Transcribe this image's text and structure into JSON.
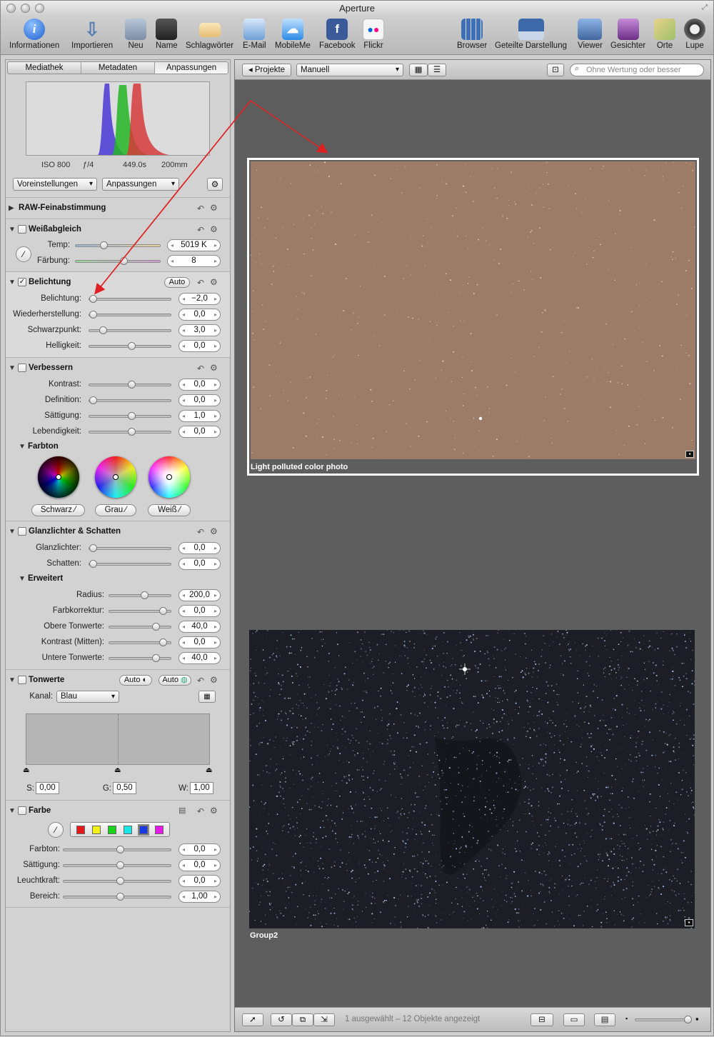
{
  "window": {
    "title": "Aperture"
  },
  "toolbar": {
    "items": [
      {
        "label": "Informationen",
        "icon": "info-icon"
      },
      {
        "label": "Importieren",
        "icon": "import-icon"
      },
      {
        "label": "Neu",
        "icon": "new-icon"
      },
      {
        "label": "Name",
        "icon": "name-icon"
      },
      {
        "label": "Schlagwörter",
        "icon": "keywords-icon"
      },
      {
        "label": "E-Mail",
        "icon": "email-icon"
      },
      {
        "label": "MobileMe",
        "icon": "mobileme-icon"
      },
      {
        "label": "Facebook",
        "icon": "facebook-icon"
      },
      {
        "label": "Flickr",
        "icon": "flickr-icon"
      },
      {
        "label": "Browser",
        "icon": "browser-icon"
      },
      {
        "label": "Geteilte Darstellung",
        "icon": "split-view-icon"
      },
      {
        "label": "Viewer",
        "icon": "viewer-icon"
      },
      {
        "label": "Gesichter",
        "icon": "faces-icon"
      },
      {
        "label": "Orte",
        "icon": "places-icon"
      },
      {
        "label": "Lupe",
        "icon": "loupe-icon"
      }
    ]
  },
  "inspector": {
    "tabs": [
      "Mediathek",
      "Metadaten",
      "Anpassungen"
    ],
    "active_tab": "Anpassungen",
    "histogram_info": {
      "iso": "ISO 800",
      "aperture": "ƒ/4",
      "shutter": "449.0s",
      "focal": "200mm"
    },
    "presets_label": "Voreinstellungen",
    "adjustments_label": "Anpassungen",
    "raw": {
      "title": "RAW-Feinabstimmung"
    },
    "wb": {
      "title": "Weißabgleich",
      "temp_label": "Temp:",
      "temp_value": "5019 K",
      "tint_label": "Färbung:",
      "tint_value": "8"
    },
    "exposure": {
      "title": "Belichtung",
      "auto": "Auto",
      "rows": [
        {
          "label": "Belichtung:",
          "value": "−2,0"
        },
        {
          "label": "Wiederherstellung:",
          "value": "0,0"
        },
        {
          "label": "Schwarzpunkt:",
          "value": "3,0"
        },
        {
          "label": "Helligkeit:",
          "value": "0,0"
        }
      ]
    },
    "enhance": {
      "title": "Verbessern",
      "rows": [
        {
          "label": "Kontrast:",
          "value": "0,0"
        },
        {
          "label": "Definition:",
          "value": "0,0"
        },
        {
          "label": "Sättigung:",
          "value": "1,0"
        },
        {
          "label": "Lebendigkeit:",
          "value": "0,0"
        }
      ],
      "tint_title": "Farbton",
      "wheels": [
        "Schwarz",
        "Grau",
        "Weiß"
      ]
    },
    "hs": {
      "title": "Glanzlichter & Schatten",
      "rows": [
        {
          "label": "Glanzlichter:",
          "value": "0,0"
        },
        {
          "label": "Schatten:",
          "value": "0,0"
        }
      ],
      "adv_title": "Erweitert",
      "adv_rows": [
        {
          "label": "Radius:",
          "value": "200,0"
        },
        {
          "label": "Farbkorrektur:",
          "value": "0,0"
        },
        {
          "label": "Obere Tonwerte:",
          "value": "40,0"
        },
        {
          "label": "Kontrast (Mitten):",
          "value": "0,0"
        },
        {
          "label": "Untere Tonwerte:",
          "value": "40,0"
        }
      ]
    },
    "levels": {
      "title": "Tonwerte",
      "auto1": "Auto",
      "auto2": "Auto",
      "channel_label": "Kanal:",
      "channel_value": "Blau",
      "s_label": "S:",
      "s_value": "0,00",
      "g_label": "G:",
      "g_value": "0,50",
      "w_label": "W:",
      "w_value": "1,00"
    },
    "color": {
      "title": "Farbe",
      "swatches": [
        "#e41a1a",
        "#f2f21a",
        "#1ad21a",
        "#1ae6e6",
        "#1a3ae6",
        "#e61ae6"
      ],
      "rows": [
        {
          "label": "Farbton:",
          "value": "0,0"
        },
        {
          "label": "Sättigung:",
          "value": "0,0"
        },
        {
          "label": "Leuchtkraft:",
          "value": "0,0"
        },
        {
          "label": "Bereich:",
          "value": "1,00"
        }
      ]
    }
  },
  "browser": {
    "projects_btn": "Projekte",
    "sort_value": "Manuell",
    "search_placeholder": "Ohne Wertung oder besser",
    "photo1_caption": "Light polluted color photo",
    "photo2_caption": "Group2",
    "status": "1 ausgewählt – 12 Objekte angezeigt"
  }
}
